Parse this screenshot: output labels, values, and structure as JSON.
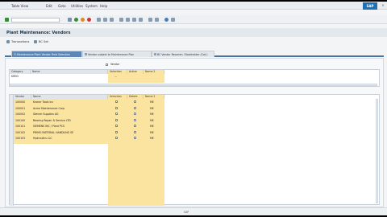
{
  "menu": {
    "items": [
      "Table View",
      "Edit",
      "Goto",
      "Utilities",
      "System",
      "Help"
    ]
  },
  "header": {
    "logo": "SAP",
    "title": "Plant Maintenance: Vendors"
  },
  "app_toolbar": {
    "buttons": [
      "Transactions",
      "BC Set"
    ]
  },
  "tabs": [
    "Maintenance Plant Vendor Field Selection",
    "Vendor subject to Maintenance Plan",
    "BC Vendor Recomm. Stockholder (Cat.)"
  ],
  "upper_grid": {
    "label": "Vendor",
    "columns": [
      "Category",
      "Name",
      "Selection",
      "Active",
      "Name 2"
    ],
    "rows": [
      {
        "category": "KRED",
        "name": "",
        "selection": "...",
        "active": "",
        "name2": ""
      }
    ]
  },
  "lower_grid": {
    "columns": [
      "Vendor",
      "Name",
      "Selection",
      "Delete",
      "Name 2"
    ],
    "rows": [
      {
        "vendor": "100000",
        "name": "Kroner Tools Inc",
        "sel": true,
        "del": false,
        "flag": "ME"
      },
      {
        "vendor": "100001",
        "name": "Acme Maintenance Corp",
        "sel": true,
        "del": false,
        "flag": "ME"
      },
      {
        "vendor": "100002",
        "name": "Steiner Supplies AG",
        "sel": true,
        "del": false,
        "flag": "ME"
      },
      {
        "vendor": "100100",
        "name": "Bearing Repair & Service LTD",
        "sel": true,
        "del": false,
        "flag": "ME"
      },
      {
        "vendor": "100101",
        "name": "SIEMENS INC / Plant PCS",
        "sel": true,
        "del": false,
        "flag": "ME"
      },
      {
        "vendor": "100102",
        "name": "PRIMO MATERIAL HANDLING SE",
        "sel": true,
        "del": false,
        "flag": "ME"
      },
      {
        "vendor": "100103",
        "name": "Hydraulics LLC",
        "sel": true,
        "del": false,
        "flag": "ME"
      }
    ]
  },
  "status": {
    "text": "SAP"
  },
  "colors": {
    "highlight": "#fbe3a0",
    "tab_active": "#5d86b5",
    "title_text": "#1e3550"
  }
}
